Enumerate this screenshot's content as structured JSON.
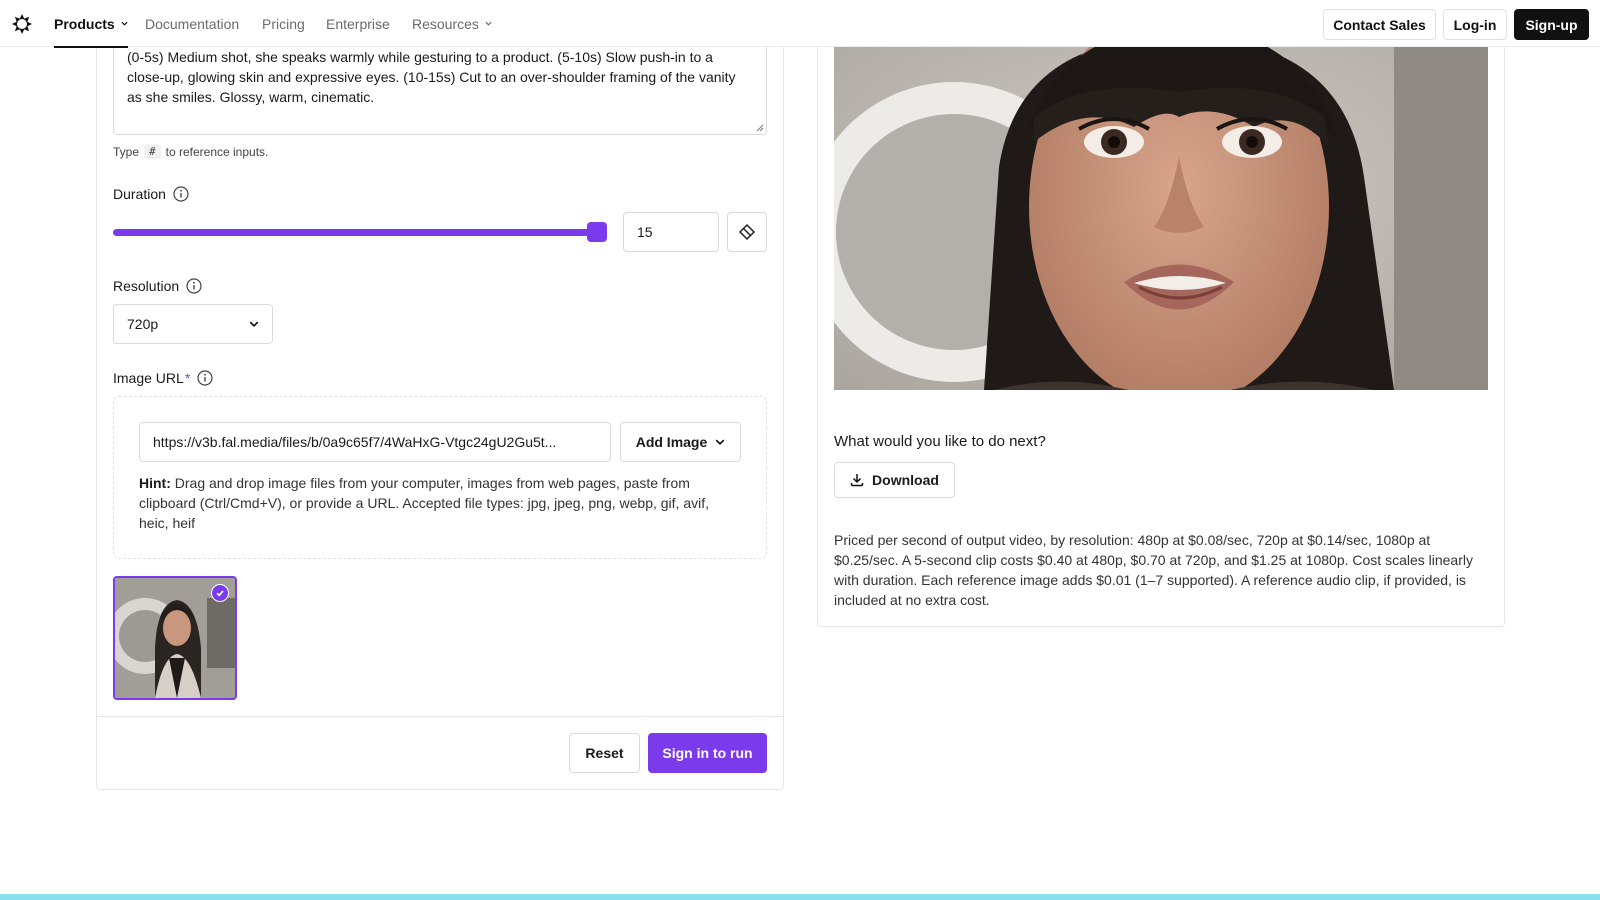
{
  "nav": {
    "items": [
      {
        "label": "Products",
        "active": true,
        "has_dropdown": true
      },
      {
        "label": "Documentation",
        "active": false,
        "has_dropdown": false
      },
      {
        "label": "Pricing",
        "active": false,
        "has_dropdown": false
      },
      {
        "label": "Enterprise",
        "active": false,
        "has_dropdown": false
      },
      {
        "label": "Resources",
        "active": false,
        "has_dropdown": true
      }
    ],
    "contact_sales": "Contact Sales",
    "login": "Log-in",
    "signup": "Sign-up"
  },
  "form": {
    "prompt_text": "(0-5s) Medium shot, she speaks warmly while gesturing to a product. (5-10s) Slow push-in to a close-up, glowing skin and expressive eyes. (10-15s) Cut to an over-shoulder framing of the vanity as she smiles. Glossy, warm, cinematic.",
    "helper_prefix": "Type",
    "helper_key": "#",
    "helper_suffix": "to reference inputs.",
    "duration": {
      "label": "Duration",
      "value": "15",
      "slider_fraction": 1.0
    },
    "resolution": {
      "label": "Resolution",
      "selected": "720p"
    },
    "image_url": {
      "label": "Image URL",
      "required_mark": "*",
      "value": "https://v3b.fal.media/files/b/0a9c65f7/4WaHxG-Vtgc24gU2Gu5t...",
      "add_image_label": "Add Image",
      "hint_bold": "Hint:",
      "hint_text": " Drag and drop image files from your computer, images from web pages, paste from clipboard (Ctrl/Cmd+V), or provide a URL. Accepted file types: jpg, jpeg, png, webp, gif, avif, heic, heif"
    },
    "reset_label": "Reset",
    "run_label": "Sign in to run"
  },
  "output": {
    "next_prompt": "What would you like to do next?",
    "download_label": "Download",
    "pricing_text": "Priced per second of output video, by resolution: 480p at $0.08/sec, 720p at $0.14/sec, 1080p at $0.25/sec. A 5-second clip costs $0.40 at 480p, $0.70 at 720p, and $1.25 at 1080p. Cost scales linearly with duration. Each reference image adds $0.01 (1–7 supported). A reference audio clip, if provided, is included at no extra cost."
  },
  "colors": {
    "accent": "#7c3aed",
    "dark": "#111111",
    "bottom_bar": "#8be0ee"
  },
  "icons": [
    "logo-icon",
    "chevron-down-icon",
    "info-icon",
    "eraser-icon",
    "download-icon",
    "check-icon",
    "resize-grip-icon"
  ]
}
